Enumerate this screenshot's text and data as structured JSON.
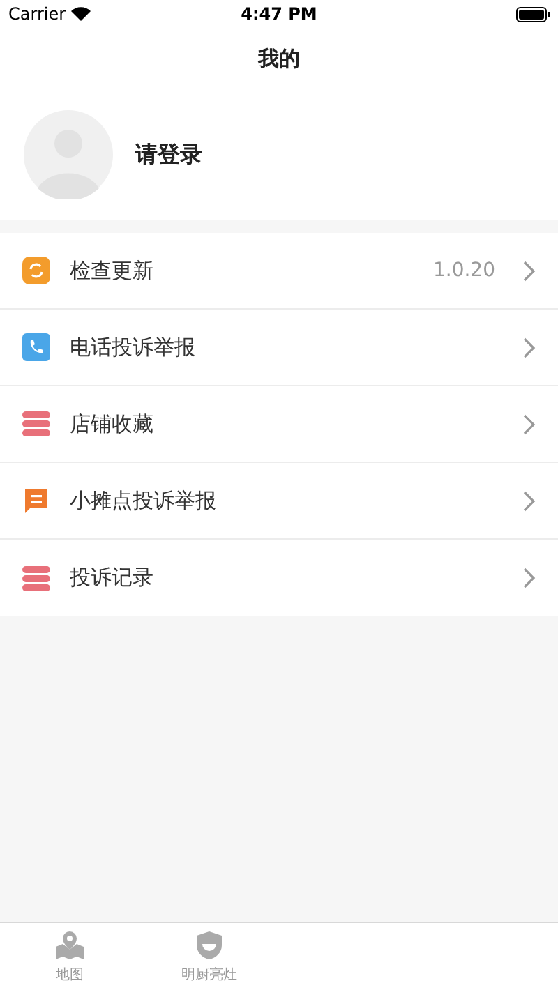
{
  "status_bar": {
    "carrier": "Carrier",
    "time": "4:47 PM"
  },
  "nav_bar": {
    "title": "我的"
  },
  "profile": {
    "login_label": "请登录"
  },
  "menu": [
    {
      "kind": "update",
      "label": "检查更新",
      "value": "1.0.20"
    },
    {
      "kind": "phone",
      "label": "电话投诉举报"
    },
    {
      "kind": "stack",
      "label": "店铺收藏"
    },
    {
      "kind": "message",
      "label": "小摊点投诉举报"
    },
    {
      "kind": "stack",
      "label": "投诉记录"
    }
  ],
  "tab_bar": [
    {
      "kind": "map",
      "label": "地图",
      "selected": false
    },
    {
      "kind": "shield",
      "label": "明厨亮灶",
      "selected": false
    }
  ]
}
